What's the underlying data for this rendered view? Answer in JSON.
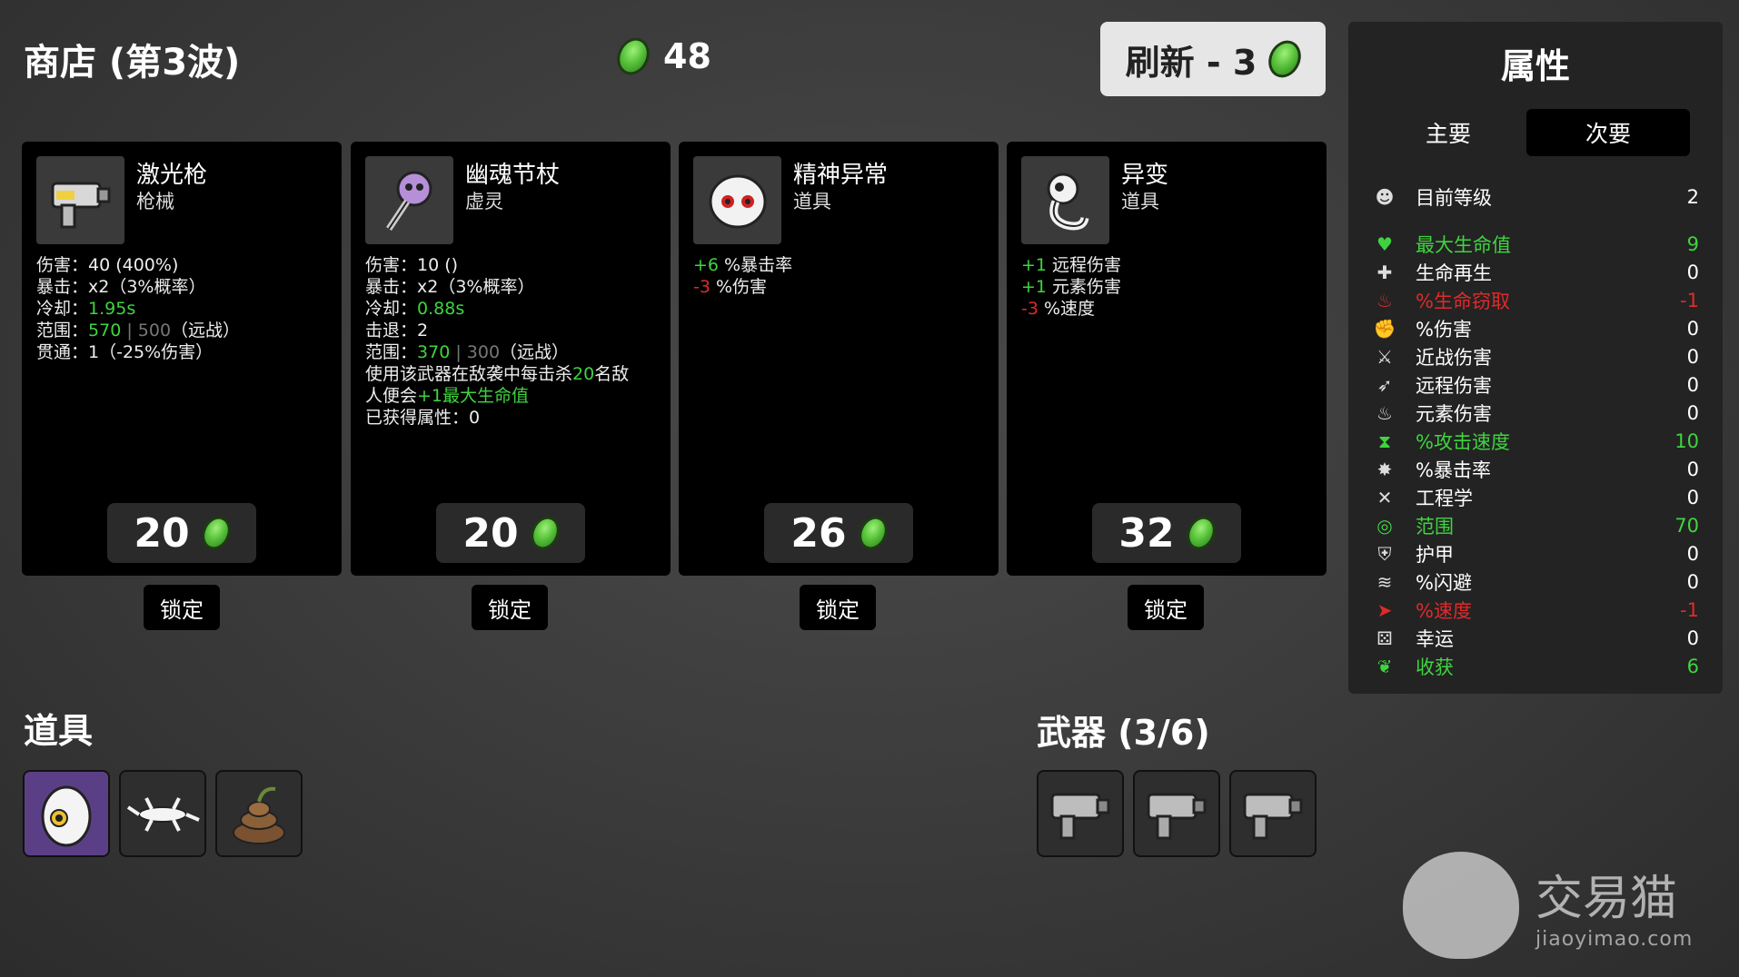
{
  "shop": {
    "title": "商店 (第3波)",
    "materials": "48",
    "refresh_label": "刷新 - 3"
  },
  "cards": [
    {
      "name": "激光枪",
      "type": "枪械",
      "price": "20",
      "lock": "锁定",
      "stats": [
        [
          {
            "t": "伤害：40 (400%"
          },
          {
            "t": ")"
          }
        ],
        [
          {
            "t": "暴击：x2（3%概率）"
          }
        ],
        [
          {
            "t": "冷却："
          },
          {
            "t": "1.95s",
            "c": "g"
          }
        ],
        [
          {
            "t": "范围："
          },
          {
            "t": "570",
            "c": "g"
          },
          {
            "t": " | 500",
            "c": "gr"
          },
          {
            "t": "（远战）"
          }
        ],
        [
          {
            "t": "贯通：1（-25%伤害）"
          }
        ]
      ]
    },
    {
      "name": "幽魂节杖",
      "type": "虚灵",
      "price": "20",
      "lock": "锁定",
      "stats": [
        [
          {
            "t": "伤害：10 ("
          },
          {
            "t": ")"
          }
        ],
        [
          {
            "t": "暴击：x2（3%概率）"
          }
        ],
        [
          {
            "t": "冷却："
          },
          {
            "t": "0.88s",
            "c": "g"
          }
        ],
        [
          {
            "t": "击退：2"
          }
        ],
        [
          {
            "t": "范围："
          },
          {
            "t": "370",
            "c": "g"
          },
          {
            "t": " | 300",
            "c": "gr"
          },
          {
            "t": "（远战）"
          }
        ],
        [
          {
            "t": "使用该武器在敌袭中每击杀"
          },
          {
            "t": "20",
            "c": "g"
          },
          {
            "t": "名敌"
          }
        ],
        [
          {
            "t": "人便会"
          },
          {
            "t": "+1最大生命值",
            "c": "g"
          }
        ],
        [
          {
            "t": "已获得属性：0"
          }
        ]
      ]
    },
    {
      "name": "精神异常",
      "type": "道具",
      "price": "26",
      "lock": "锁定",
      "stats": [
        [
          {
            "t": "+6",
            "c": "g"
          },
          {
            "t": " %暴击率"
          }
        ],
        [
          {
            "t": "-3",
            "c": "r"
          },
          {
            "t": " %伤害"
          }
        ]
      ]
    },
    {
      "name": "异变",
      "type": "道具",
      "price": "32",
      "lock": "锁定",
      "stats": [
        [
          {
            "t": "+1",
            "c": "g"
          },
          {
            "t": " 远程伤害"
          }
        ],
        [
          {
            "t": "+1",
            "c": "g"
          },
          {
            "t": " 元素伤害"
          }
        ],
        [
          {
            "t": "-3",
            "c": "r"
          },
          {
            "t": " %速度"
          }
        ]
      ]
    }
  ],
  "items": {
    "title": "道具",
    "slots": [
      "egg-icon",
      "lizard-icon",
      "poop-icon"
    ]
  },
  "weapons": {
    "title": "武器 (3/6)",
    "slots": [
      "laser-gun-icon",
      "laser-gun-icon",
      "laser-gun-icon"
    ]
  },
  "stats_panel": {
    "title": "属性",
    "tab_primary": "主要",
    "tab_secondary": "次要",
    "rows": [
      {
        "label": "目前等级",
        "value": "2",
        "color": "#ffffff",
        "icon": "level-icon"
      },
      {
        "label": "最大生命值",
        "value": "9",
        "color": "#3fd43f",
        "icon": "heart-icon"
      },
      {
        "label": "生命再生",
        "value": "0",
        "color": "#ffffff",
        "icon": "regen-icon"
      },
      {
        "label": "%生命窃取",
        "value": "-1",
        "color": "#e02a2a",
        "icon": "lifesteal-icon"
      },
      {
        "label": "%伤害",
        "value": "0",
        "color": "#ffffff",
        "icon": "damage-icon"
      },
      {
        "label": "近战伤害",
        "value": "0",
        "color": "#ffffff",
        "icon": "melee-icon"
      },
      {
        "label": "远程伤害",
        "value": "0",
        "color": "#ffffff",
        "icon": "ranged-icon"
      },
      {
        "label": "元素伤害",
        "value": "0",
        "color": "#ffffff",
        "icon": "elemental-icon"
      },
      {
        "label": "%攻击速度",
        "value": "10",
        "color": "#3fd43f",
        "icon": "attack-speed-icon"
      },
      {
        "label": "%暴击率",
        "value": "0",
        "color": "#ffffff",
        "icon": "crit-icon"
      },
      {
        "label": "工程学",
        "value": "0",
        "color": "#ffffff",
        "icon": "engineering-icon"
      },
      {
        "label": "范围",
        "value": "70",
        "color": "#3fd43f",
        "icon": "range-icon"
      },
      {
        "label": "护甲",
        "value": "0",
        "color": "#ffffff",
        "icon": "armor-icon"
      },
      {
        "label": "%闪避",
        "value": "0",
        "color": "#ffffff",
        "icon": "dodge-icon"
      },
      {
        "label": "%速度",
        "value": "-1",
        "color": "#e02a2a",
        "icon": "speed-icon"
      },
      {
        "label": "幸运",
        "value": "0",
        "color": "#ffffff",
        "icon": "luck-icon"
      },
      {
        "label": "收获",
        "value": "6",
        "color": "#3fd43f",
        "icon": "harvest-icon"
      }
    ]
  },
  "watermark": {
    "cn": "交易猫",
    "en": "jiaoyimao.com"
  }
}
